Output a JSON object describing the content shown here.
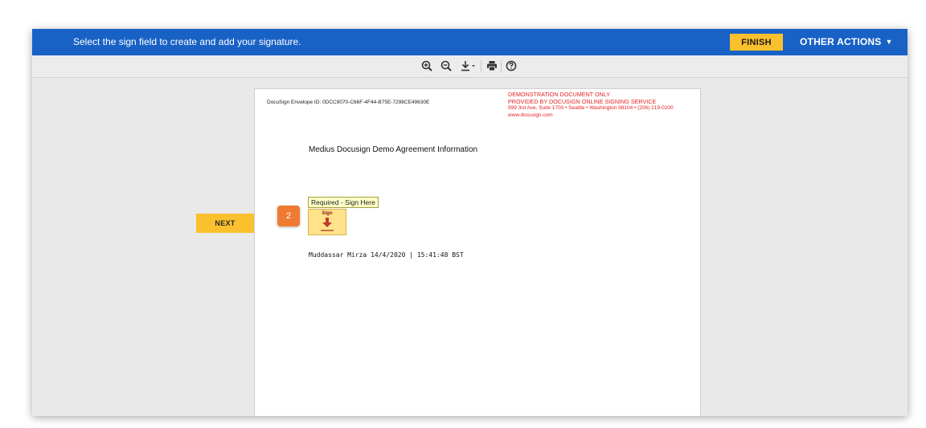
{
  "header": {
    "instruction": "Select the sign field to create and add your signature.",
    "finish_label": "FINISH",
    "other_actions_label": "OTHER ACTIONS",
    "other_actions_caret": "▼"
  },
  "toolbar": {
    "icons": [
      "zoom-in-icon",
      "zoom-out-icon",
      "download-icon",
      "print-icon",
      "help-icon"
    ]
  },
  "document": {
    "envelope_id": "DocuSign Envelope ID: 0DCC9070-C66F-4F44-B75E-7298CE49630E",
    "demo_stamp": {
      "line1": "DEMONSTRATION DOCUMENT ONLY",
      "line2": "PROVIDED BY DOCUSIGN ONLINE SIGNING SERVICE",
      "line3": "999 3rd Ave, Suite 1700  • Seattle • Washington 98104 • (206) 219-0200",
      "line4": "www.docusign.com"
    },
    "title": "Medius Docusign Demo Agreement Information",
    "tooltip": "Required - Sign Here",
    "sign_field_label": "Sign",
    "signature_line": "Muddassar Mirza 14/4/2020 | 15:41:48 BST"
  },
  "navigation": {
    "next_label": "NEXT"
  },
  "step_badge": "2",
  "colors": {
    "header_blue": "#1862c6",
    "accent_yellow": "#fbc02d",
    "demo_red": "#e32222",
    "badge_orange": "#ef7b32"
  }
}
